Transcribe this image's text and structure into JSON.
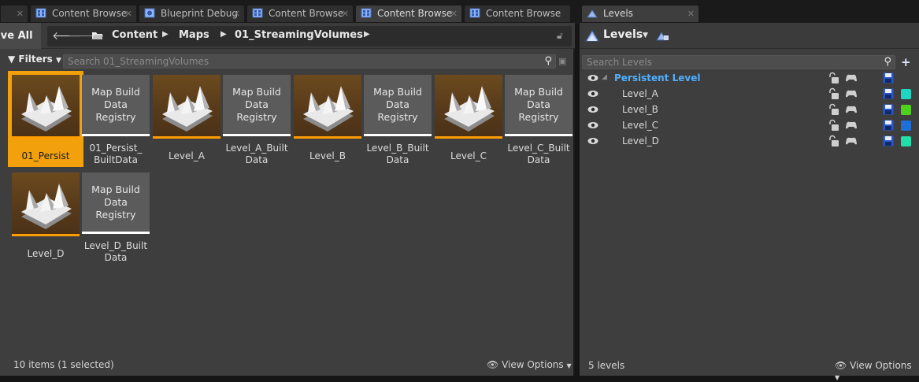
{
  "tabs": [
    {
      "label": ""
    },
    {
      "label": "Content Browse"
    },
    {
      "label": "Blueprint Debug"
    },
    {
      "label": "Content Browse"
    },
    {
      "label": "Content Browse"
    },
    {
      "label": "Content Browse"
    }
  ],
  "levels_tab": {
    "label": "Levels"
  },
  "toolbar": {
    "save_all": "ave All"
  },
  "breadcrumb": [
    "Content",
    "Maps",
    "01_StreamingVolumes"
  ],
  "filters_label": "Filters",
  "asset_search": {
    "placeholder": "Search 01_StreamingVolumes"
  },
  "assets": [
    {
      "kind": "map",
      "label": "01_Persist",
      "selected": true
    },
    {
      "kind": "reg",
      "thumb": [
        "Map Build",
        "Data",
        "Registry"
      ],
      "label": "01_Persist_\nBuiltData"
    },
    {
      "kind": "map",
      "label": "Level_A"
    },
    {
      "kind": "reg",
      "thumb": [
        "Map Build",
        "Data",
        "Registry"
      ],
      "label": "Level_A_Built\nData"
    },
    {
      "kind": "map",
      "label": "Level_B"
    },
    {
      "kind": "reg",
      "thumb": [
        "Map Build",
        "Data",
        "Registry"
      ],
      "label": "Level_B_Built\nData"
    },
    {
      "kind": "map",
      "label": "Level_C"
    },
    {
      "kind": "reg",
      "thumb": [
        "Map Build",
        "Data",
        "Registry"
      ],
      "label": "Level_C_Built\nData"
    },
    {
      "kind": "map",
      "label": "Level_D"
    },
    {
      "kind": "reg",
      "thumb": [
        "Map Build",
        "Data",
        "Registry"
      ],
      "label": "Level_D_Built\nData"
    }
  ],
  "content_status": "10 items (1 selected)",
  "view_options": "View Options",
  "levels_panel": {
    "title": "Levels",
    "search_placeholder": "Search Levels",
    "persistent": "Persistent Level",
    "levels": [
      {
        "name": "Level_A",
        "color": "#1fd6c2"
      },
      {
        "name": "Level_B",
        "color": "#4fd21a"
      },
      {
        "name": "Level_C",
        "color": "#1f6fd8"
      },
      {
        "name": "Level_D",
        "color": "#1ee0a8"
      }
    ],
    "status": "5 levels",
    "view_options": "View Options"
  },
  "colors": {
    "accent_orange": "#ff9c00",
    "selection": "#f2a10d",
    "persistent_blue": "#4fb0ff"
  }
}
